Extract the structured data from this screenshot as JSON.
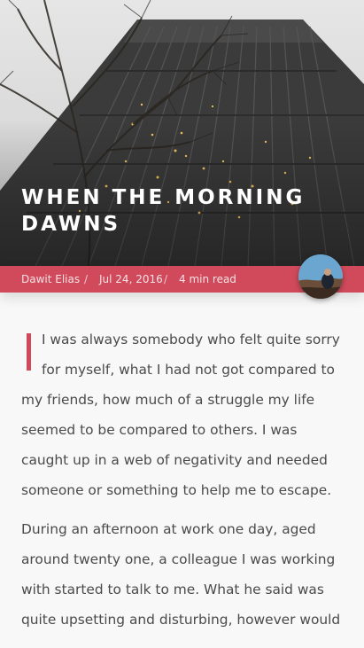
{
  "post": {
    "title": "When the morning dawns",
    "author": "Dawit Elias",
    "separator": "/",
    "date": "Jul 24, 2016",
    "read_time": "4 min read"
  },
  "article": {
    "paragraph_1": "I was always somebody who felt quite sorry for myself, what I had not got compared to my friends, how much of a struggle my life seemed to be compared to others. I was caught up in a web of negativity and needed someone or something to help me to escape.",
    "paragraph_2": "During an afternoon at work one day, aged around twenty one, a colleague I was working with started to talk to me. What he said was quite upsetting and disturbing, however would"
  },
  "colors": {
    "accent": "#d04a5b",
    "body_text": "#4a4a4a",
    "background": "#f8f8f8"
  }
}
